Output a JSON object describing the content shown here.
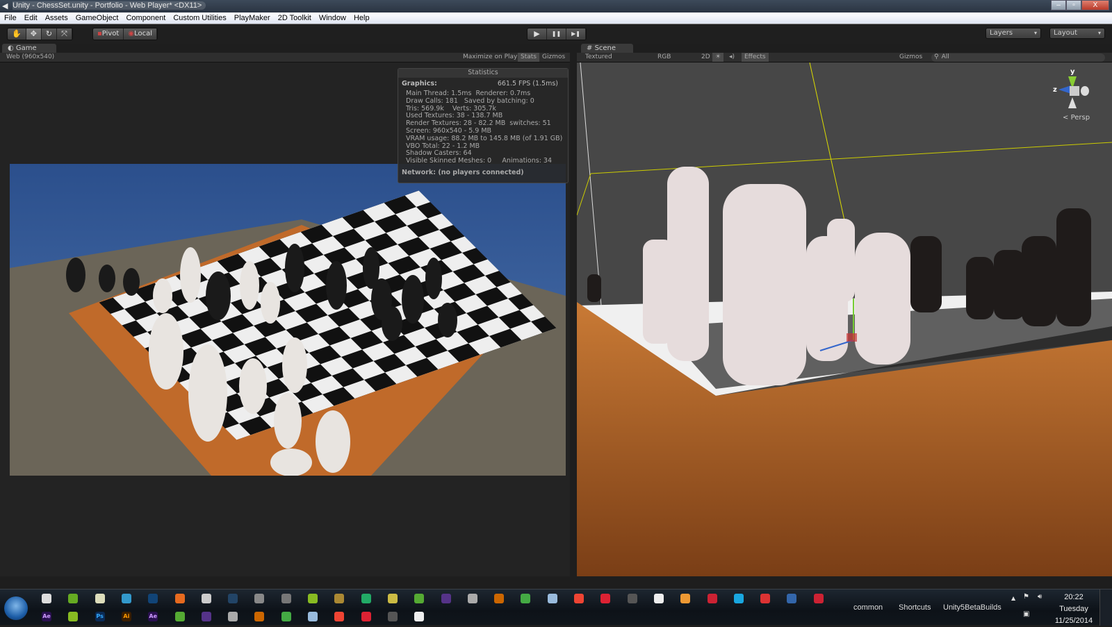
{
  "window": {
    "title": "Unity - ChessSet.unity - Portfolio - Web Player* <DX11>",
    "controls": [
      "minimize",
      "restore",
      "close"
    ]
  },
  "menu": [
    "File",
    "Edit",
    "Assets",
    "GameObject",
    "Component",
    "Custom Utilities",
    "PlayMaker",
    "2D Toolkit",
    "Window",
    "Help"
  ],
  "toolbar": {
    "tools": [
      "hand-icon",
      "move-icon",
      "rotate-icon",
      "scale-icon"
    ],
    "active_tool": "move",
    "pivot": "Pivot",
    "local": "Local",
    "play": "▶",
    "pause": "❚❚",
    "step": "▶❚",
    "layers": "Layers",
    "layout": "Layout"
  },
  "game": {
    "tab": "Game",
    "resolution": "Web (960x540)",
    "maximize": "Maximize on Play",
    "stats": "Stats",
    "gizmos": "Gizmos",
    "statistics": {
      "title": "Statistics",
      "graphics_label": "Graphics:",
      "fps": "661.5 FPS (1.5ms)",
      "lines": [
        "Main Thread: 1.5ms  Renderer: 0.7ms",
        "Draw Calls: 181   Saved by batching: 0",
        "Tris: 569.9k    Verts: 305.7k",
        "Used Textures: 38 - 138.7 MB",
        "Render Textures: 28 - 82.2 MB  switches: 51",
        "Screen: 960x540 - 5.9 MB",
        "VRAM usage: 88.2 MB to 145.8 MB (of 1.91 GB)",
        "VBO Total: 22 - 1.2 MB",
        "Shadow Casters: 64",
        "Visible Skinned Meshes: 0     Animations: 34"
      ],
      "network": "Network: (no players connected)"
    }
  },
  "scene": {
    "tab": "Scene",
    "render_mode": "Textured",
    "channel": "RGB",
    "mode_2d": "2D",
    "effects": "Effects",
    "gizmos": "Gizmos",
    "search_placeholder": "All",
    "gizmo_axes": {
      "y": "y",
      "z": "z"
    },
    "projection": "Persp"
  },
  "taskbar": {
    "row1": [
      "clock",
      "network-tool",
      "skype",
      "tool",
      "logitech",
      "firefox",
      "chrome",
      "nvidia",
      "utorrent",
      "itunes",
      "spotify",
      "bm",
      "chat",
      "notepad",
      "notes",
      "visual-studio",
      "league",
      "warcraft",
      "hearthstone",
      "steam",
      "origin",
      "uplay",
      "pen",
      "app1",
      "app2",
      "app3",
      "app4",
      "app5",
      "photoshop",
      "illustrator"
    ],
    "row2": [
      "Ae",
      "media-encoder",
      "Ps",
      "Ai",
      "Ae",
      "blender",
      "inkscape",
      "maya",
      "unity",
      "camtasia",
      "tool2",
      "explorer",
      "google-earth",
      "paint",
      "sketchup"
    ],
    "toolbars": [
      "common",
      "Shortcuts",
      "Unity5BetaBuilds"
    ],
    "clock": {
      "time": "20:22",
      "day": "Tuesday",
      "date": "11/25/2014"
    }
  }
}
